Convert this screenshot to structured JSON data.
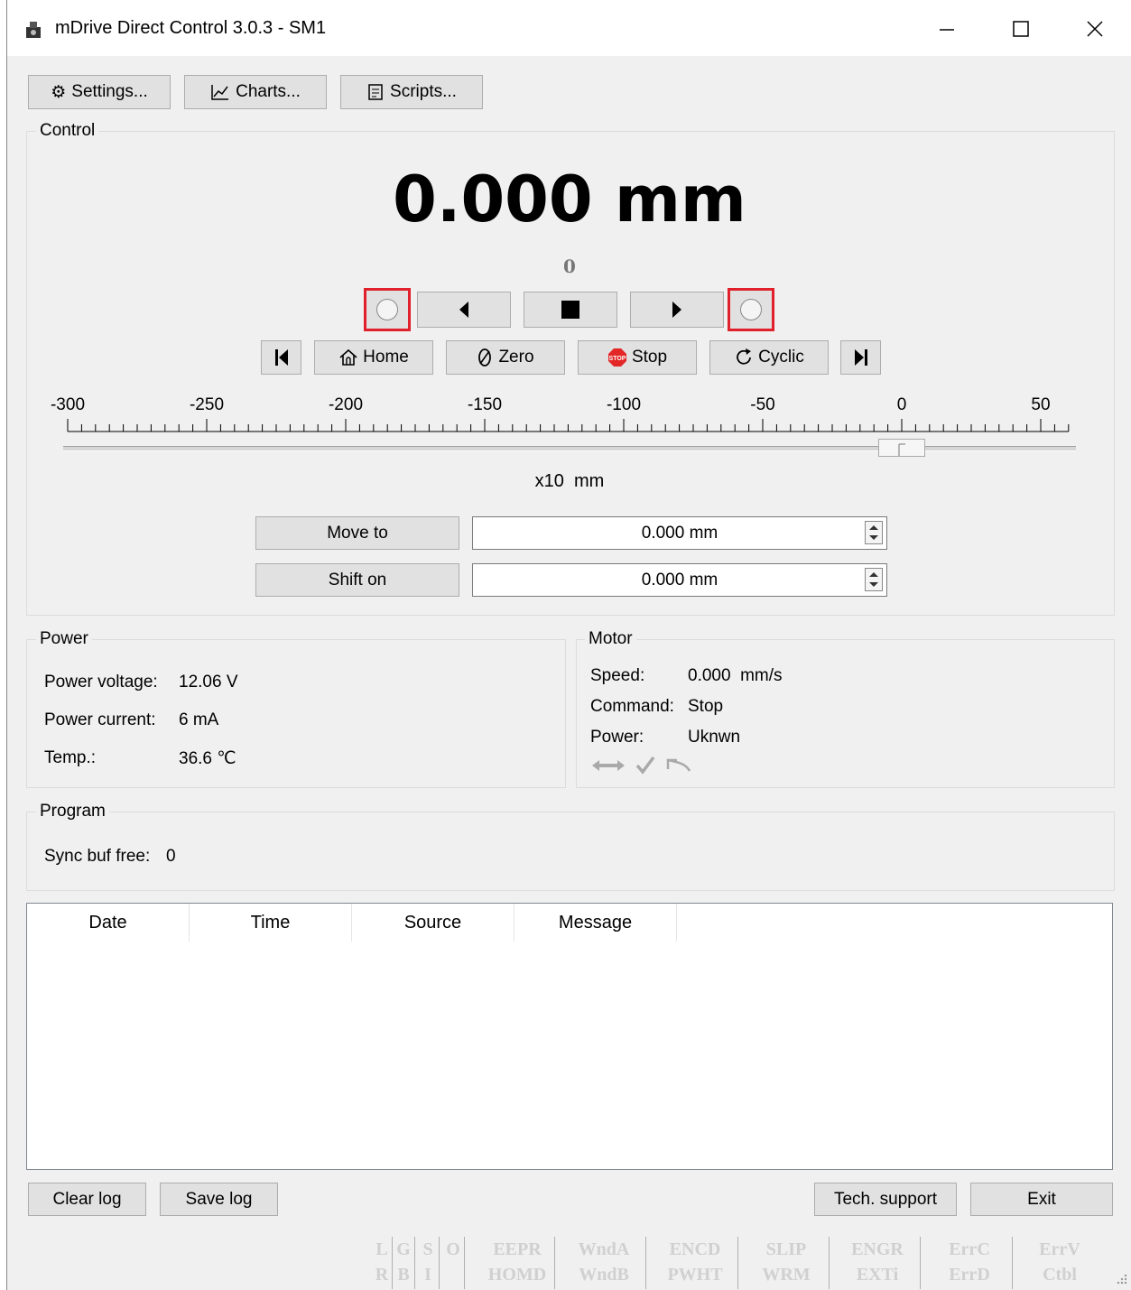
{
  "window": {
    "title": "mDrive Direct Control 3.0.3 - SM1",
    "minimize_glyph": "—",
    "maximize_glyph": "☐",
    "close_glyph": "✕"
  },
  "toolbar": {
    "settings_label": "Settings...",
    "charts_label": "Charts...",
    "scripts_label": "Scripts..."
  },
  "control": {
    "group_label": "Control",
    "position": "0.000 mm",
    "steps": "0",
    "home_label": "Home",
    "zero_label": "Zero",
    "stop_label": "Stop",
    "cyclic_label": "Cyclic",
    "ruler_ticks": [
      "-300",
      "-250",
      "-200",
      "-150",
      "-100",
      "-50",
      "0",
      "50"
    ],
    "ruler_unit": "x10  mm",
    "slider_value": 0,
    "move_to_label": "Move to",
    "move_to_value": "0.000 mm",
    "shift_on_label": "Shift on",
    "shift_on_value": "0.000 mm"
  },
  "power": {
    "group_label": "Power",
    "voltage_label": "Power voltage:",
    "voltage_value": "12.06 V",
    "current_label": "Power current:",
    "current_value": "6 mA",
    "temp_label": "Temp.:",
    "temp_value": "36.6 ℃"
  },
  "motor": {
    "group_label": "Motor",
    "speed_label": "Speed:",
    "speed_value": "0.000  mm/s",
    "command_label": "Command:",
    "command_value": "Stop",
    "power_label": "Power:",
    "power_value": "Uknwn"
  },
  "program": {
    "group_label": "Program",
    "sync_label": "Sync buf free:",
    "sync_value": "0"
  },
  "log": {
    "columns": [
      "Date",
      "Time",
      "Source",
      "Message"
    ]
  },
  "bottom": {
    "clear_log_label": "Clear log",
    "save_log_label": "Save log",
    "tech_support_label": "Tech. support",
    "exit_label": "Exit"
  },
  "status_flags": [
    {
      "top": "L",
      "bottom": "R"
    },
    {
      "top": "G",
      "bottom": "B"
    },
    {
      "top": "S",
      "bottom": "I"
    },
    {
      "top": "O",
      "bottom": ""
    },
    {
      "top": "EEPR",
      "bottom": "HOMD"
    },
    {
      "top": "WndA",
      "bottom": "WndB"
    },
    {
      "top": "ENCD",
      "bottom": "PWHT"
    },
    {
      "top": "SLIP",
      "bottom": "WRM"
    },
    {
      "top": "ENGR",
      "bottom": "EXTi"
    },
    {
      "top": "ErrC",
      "bottom": "ErrD"
    },
    {
      "top": "ErrV",
      "bottom": "Ctbl"
    }
  ]
}
